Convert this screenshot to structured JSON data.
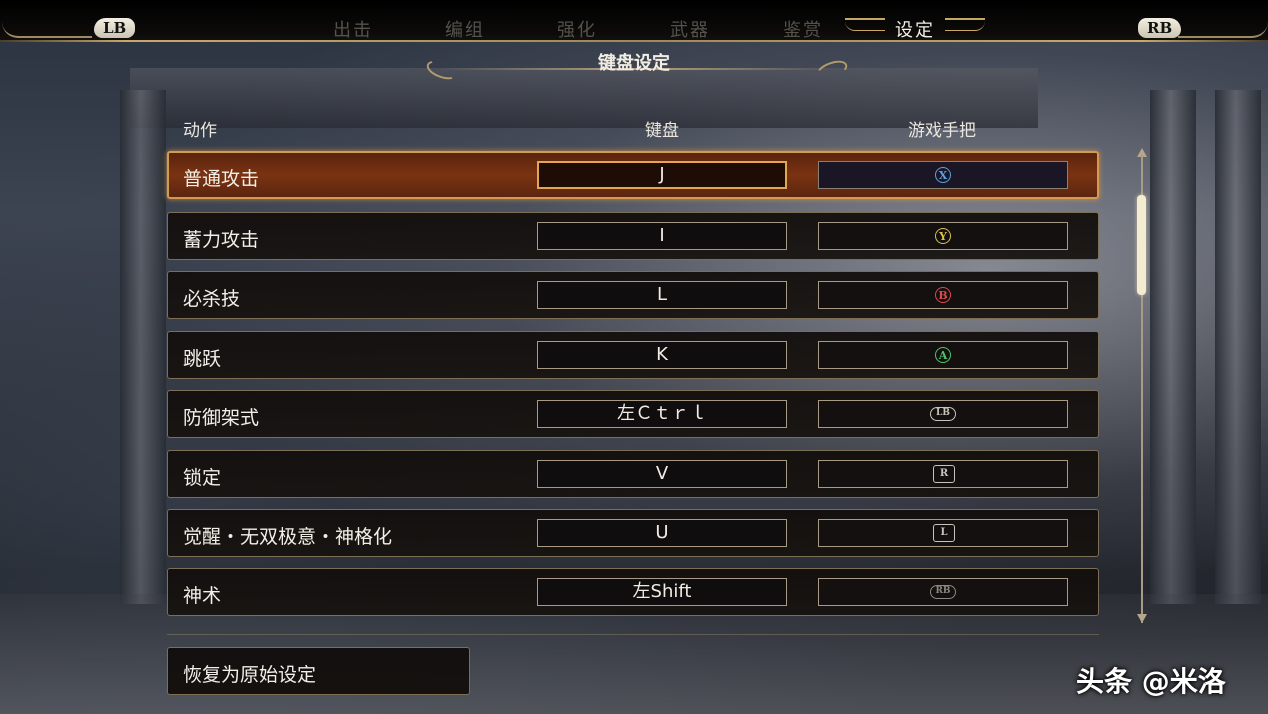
{
  "nav": {
    "left_bumper": "LB",
    "right_bumper": "RB",
    "tabs": [
      "出击",
      "编组",
      "强化",
      "武器",
      "鉴赏",
      "设定"
    ],
    "active_tab": "设定"
  },
  "section_title": "键盘设定",
  "headers": {
    "action": "动作",
    "keyboard": "键盘",
    "gamepad": "游戏手把"
  },
  "bindings": [
    {
      "action": "普通攻击",
      "key": "J",
      "pad": "X",
      "pad_color": "#5aa3e0",
      "selected": true
    },
    {
      "action": "蓄力攻击",
      "key": "I",
      "pad": "Y",
      "pad_color": "#d7c24a"
    },
    {
      "action": "必杀技",
      "key": "L",
      "pad": "B",
      "pad_color": "#d94a4a"
    },
    {
      "action": "跳跃",
      "key": "K",
      "pad": "A",
      "pad_color": "#4fc46a"
    },
    {
      "action": "防御架式",
      "key": "左Ｃｔｒｌ",
      "pad": "LB"
    },
    {
      "action": "锁定",
      "key": "V",
      "pad": "R"
    },
    {
      "action": "觉醒・无双极意・神格化",
      "key": "U",
      "pad": "L"
    },
    {
      "action": "神术",
      "key": "左Shift",
      "pad": "RB"
    }
  ],
  "reset_button": "恢复为原始设定",
  "watermark": "头条 @米洛",
  "colors": {
    "accent_gold": "#c9a96a",
    "selected_row": "#7a3312",
    "selected_border": "#d49a4e"
  }
}
